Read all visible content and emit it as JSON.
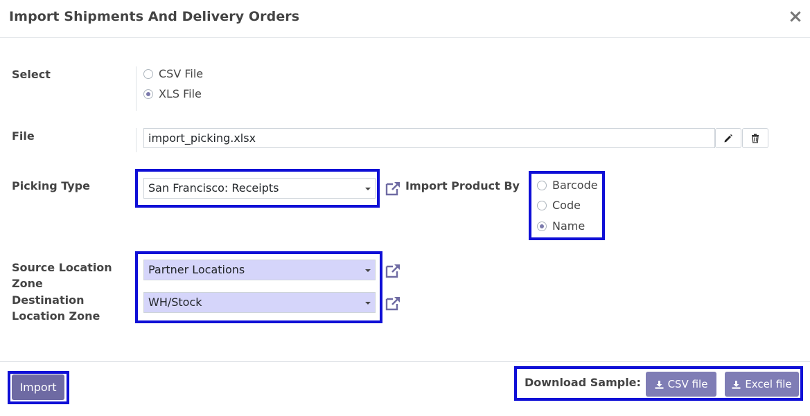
{
  "dialog": {
    "title": "Import Shipments And Delivery Orders",
    "close_glyph": "×"
  },
  "form": {
    "select_label": "Select",
    "file_type_options": [
      {
        "label": "CSV File",
        "checked": false
      },
      {
        "label": "XLS File",
        "checked": true
      }
    ],
    "file_label": "File",
    "file_value": "import_picking.xlsx",
    "picking_type_label": "Picking Type",
    "picking_type_value": "San Francisco: Receipts",
    "import_product_by_label": "Import Product By",
    "import_product_by_options": [
      {
        "label": "Barcode",
        "checked": false
      },
      {
        "label": "Code",
        "checked": false
      },
      {
        "label": "Name",
        "checked": true
      }
    ],
    "source_location_label_line1": "Source Location",
    "source_location_label_line2": "Zone",
    "source_location_value": "Partner Locations",
    "destination_location_label_line1": "Destination",
    "destination_location_label_line2": "Location Zone",
    "destination_location_value": "WH/Stock"
  },
  "footer": {
    "import_label": "Import",
    "download_sample_label": "Download Sample:",
    "csv_file_label": "CSV file",
    "excel_file_label": "Excel file"
  },
  "icons": {
    "edit": "pencil-icon",
    "delete": "trash-icon",
    "external": "external-link-icon",
    "download": "download-icon",
    "dropdown": "caret-down-icon"
  },
  "colors": {
    "primary": "#6e6aa3",
    "secondary": "#7f7db5",
    "highlight_box": "#0f0fd6",
    "selected_field_bg": "#d5d5fa"
  }
}
